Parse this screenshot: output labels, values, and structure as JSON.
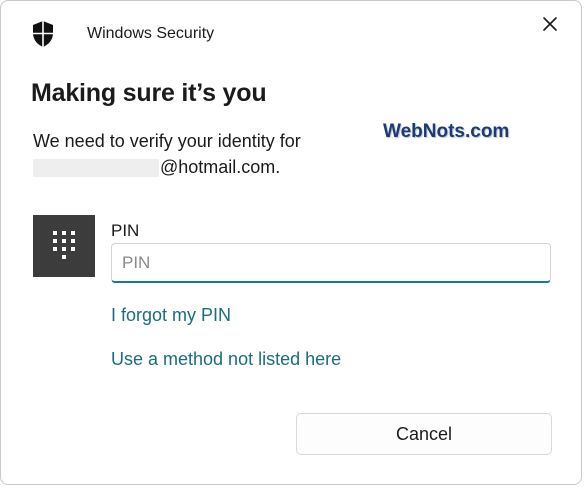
{
  "window": {
    "app_title": "Windows Security",
    "icons": {
      "app": "shield-icon",
      "close": "close-icon"
    }
  },
  "content": {
    "heading": "Making sure it’s you",
    "description_line1": "We need to verify your identity for",
    "email_suffix": "@hotmail.com."
  },
  "watermark": {
    "text": "WebNots.com"
  },
  "pin": {
    "icon": "keypad-icon",
    "label": "PIN",
    "placeholder": "PIN",
    "value": ""
  },
  "links": {
    "forgot_pin": "I forgot my PIN",
    "other_method": "Use a method not listed here"
  },
  "buttons": {
    "cancel": "Cancel"
  },
  "colors": {
    "accent": "#1a7a8a",
    "link": "#1a6d7c",
    "keypad_tile": "#3c3c3c",
    "watermark": "#1f3a72"
  }
}
